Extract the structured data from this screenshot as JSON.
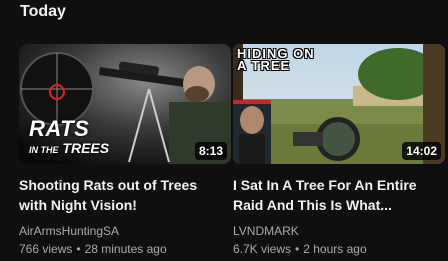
{
  "section": {
    "title": "Today"
  },
  "videos": [
    {
      "title_line1": "Shooting Rats out of Trees",
      "title_line2": "with Night Vision!",
      "channel": "AirArmsHuntingSA",
      "views": "766 views",
      "age": "28 minutes ago",
      "duration": "8:13",
      "thumb_text_main": "RATS",
      "thumb_text_sub_small": "IN THE",
      "thumb_text_sub": "TREES"
    },
    {
      "title_line1": "I Sat In A Tree For An Entire",
      "title_line2": "Raid And This Is What...",
      "channel": "LVNDMARK",
      "views": "6.7K views",
      "age": "2 hours ago",
      "duration": "14:02",
      "thumb_text_line1": "HIDING ON",
      "thumb_text_line2": "A TREE"
    }
  ],
  "separator": "•"
}
